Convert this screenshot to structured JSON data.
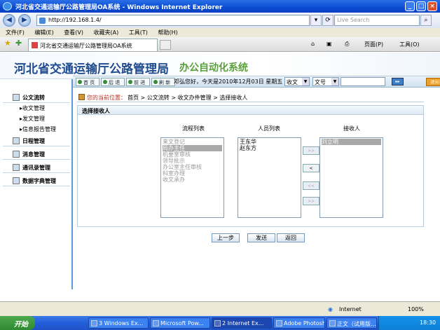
{
  "window": {
    "title": "河北省交通运输厅公路管理局OA系统 - Windows Internet Explorer"
  },
  "browser": {
    "address": "http://192.168.1.4/",
    "search_placeholder": "Live Search",
    "tab_title": "河北省交通运输厅公路管理局OA系统",
    "menu": [
      "文件(F)",
      "编辑(E)",
      "查看(V)",
      "收藏夹(A)",
      "工具(T)",
      "帮助(H)"
    ],
    "tab_tools": {
      "page": "页面(P)",
      "tools": "工具(O)"
    },
    "status": {
      "zone": "Internet",
      "zoom": "100%"
    }
  },
  "app": {
    "title": "河北省交通运输厅公路管理局",
    "subtitle": "办公自动化系统",
    "toolbar": {
      "home": "首 页",
      "back": "后 退",
      "forward": "前 进",
      "refresh": "刷 新"
    },
    "greeting": "邓弘您好，今天是2010年12月03日 星期五",
    "filter1": "收文",
    "filter2": "文号",
    "exit_label": "退出系统"
  },
  "sidebar": {
    "items": [
      {
        "label": "公文流转",
        "subs": [
          "收文管理",
          "发文管理",
          "信息报告管理"
        ]
      },
      {
        "label": "日程管理"
      },
      {
        "label": "消息管理"
      },
      {
        "label": "通讯录管理"
      },
      {
        "label": "数据字典管理"
      }
    ]
  },
  "breadcrumb": {
    "label": "您的当前位置：",
    "path": "首页 > 公文流转 > 收文办件管理 > 选择接收人"
  },
  "section": {
    "title": "选择接收人"
  },
  "columns": {
    "flow": "流程列表",
    "people": "人员列表",
    "receiver": "接收人"
  },
  "flow_list": [
    "来文登记",
    "局办主任",
    "机要室审核",
    "领导批示",
    "办公室主任审核",
    "科室办理",
    "收文承办"
  ],
  "people_list": [
    "王东华",
    "赵东方"
  ],
  "receiver_list": [
    "刘立明"
  ],
  "arrows": [
    ">>",
    "<",
    "<<",
    ">>"
  ],
  "buttons": {
    "prev": "上一步",
    "send": "发送",
    "back": "返回"
  },
  "taskbar": {
    "start": "开始",
    "tasks": [
      "3 Windows Ex...",
      "Microsoft Pow...",
      "2 Internet Ex...",
      "Adobe Photosh...",
      "正文（试用版..."
    ],
    "clock": "18:30"
  }
}
